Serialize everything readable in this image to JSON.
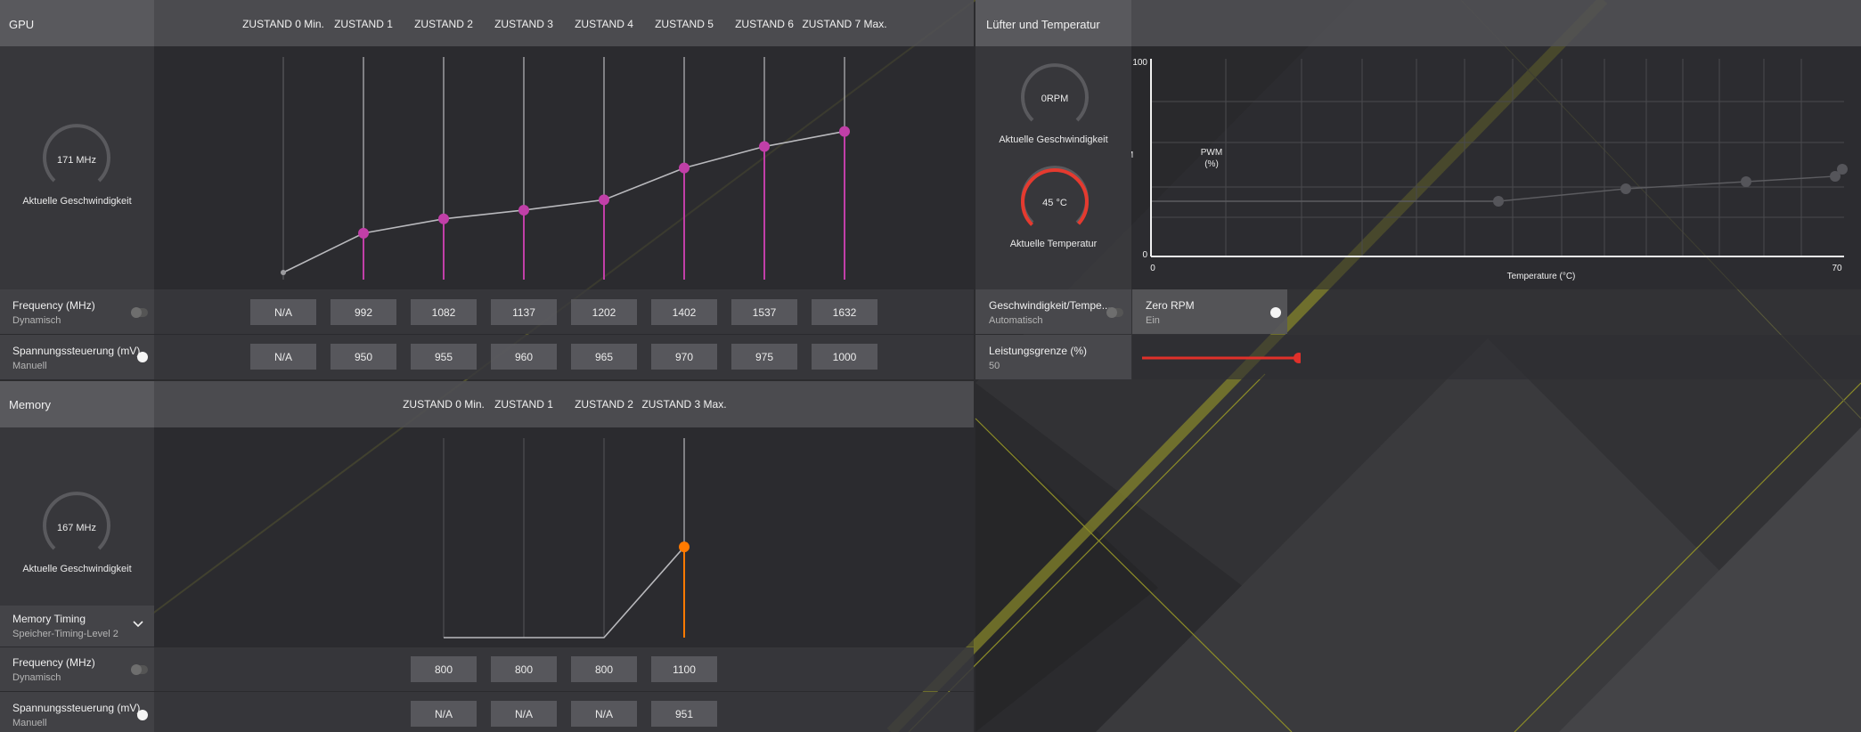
{
  "gpu": {
    "title": "GPU",
    "states": [
      "ZUSTAND 0 Min.",
      "ZUSTAND 1",
      "ZUSTAND 2",
      "ZUSTAND 3",
      "ZUSTAND 4",
      "ZUSTAND 5",
      "ZUSTAND 6",
      "ZUSTAND 7 Max."
    ],
    "gauge_value": "171 MHz",
    "gauge_label": "Aktuelle Geschwindigkeit",
    "frequency": {
      "title": "Frequency (MHz)",
      "mode": "Dynamisch",
      "values": [
        "N/A",
        "992",
        "1082",
        "1137",
        "1202",
        "1402",
        "1537",
        "1632"
      ]
    },
    "voltage": {
      "title": "Spannungssteuerung (mV)",
      "mode": "Manuell",
      "values": [
        "N/A",
        "950",
        "955",
        "960",
        "965",
        "970",
        "975",
        "1000"
      ]
    }
  },
  "memory": {
    "title": "Memory",
    "states": [
      "ZUSTAND 0 Min.",
      "ZUSTAND 1",
      "ZUSTAND 2",
      "ZUSTAND 3 Max."
    ],
    "gauge_value": "167 MHz",
    "gauge_label": "Aktuelle Geschwindigkeit",
    "timing": {
      "title": "Memory Timing",
      "value": "Speicher-Timing-Level 2"
    },
    "frequency": {
      "title": "Frequency (MHz)",
      "mode": "Dynamisch",
      "values": [
        "800",
        "800",
        "800",
        "1100"
      ]
    },
    "voltage": {
      "title": "Spannungssteuerung (mV)",
      "mode": "Manuell",
      "values": [
        "N/A",
        "N/A",
        "N/A",
        "951"
      ]
    }
  },
  "fan": {
    "title": "Lüfter und Temperatur",
    "rpm_value": "0RPM",
    "rpm_label": "Aktuelle Geschwindigkeit",
    "temp_value": "45 °C",
    "temp_label": "Aktuelle Temperatur",
    "temp_level": 0.45,
    "chart": {
      "ylabel_line1": "PWM",
      "ylabel_line2": "(%)",
      "y_max_label": "100",
      "y_min_label": "0",
      "x_min_label": "0",
      "x_max_label": "70",
      "xlabel": "Temperature (°C)"
    },
    "speed_temp": {
      "title": "Geschwindigkeit/Tempe...",
      "mode": "Automatisch"
    },
    "zero_rpm": {
      "title": "Zero RPM",
      "state": "Ein"
    },
    "power_limit": {
      "title": "Leistungsgrenze (%)",
      "value": "50",
      "level": 0.5
    }
  },
  "colors": {
    "gpu_accent": "#c13fa8",
    "memory_accent": "#ff7a00",
    "temp_accent": "#e53a2f",
    "slider": "#e0302a"
  },
  "chart_data": [
    {
      "type": "line",
      "categories": [
        "ZUSTAND 0 Min.",
        "ZUSTAND 1",
        "ZUSTAND 2",
        "ZUSTAND 3",
        "ZUSTAND 4",
        "ZUSTAND 5",
        "ZUSTAND 6",
        "ZUSTAND 7 Max."
      ],
      "values": [
        null,
        992,
        1082,
        1137,
        1202,
        1402,
        1537,
        1632
      ]
    },
    {
      "type": "line",
      "categories": [
        "ZUSTAND 0 Min.",
        "ZUSTAND 1",
        "ZUSTAND 2",
        "ZUSTAND 3 Max."
      ],
      "values": [
        800,
        800,
        800,
        1100
      ]
    }
  ]
}
